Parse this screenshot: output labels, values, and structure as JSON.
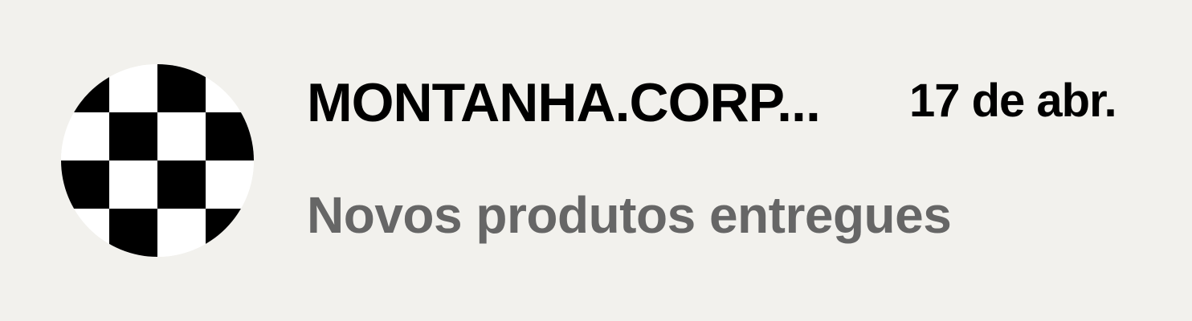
{
  "notification": {
    "sender": "MONTANHA.CORP...",
    "date": "17 de abr.",
    "subject": "Novos produtos entregues",
    "avatar_icon": "checkerboard-logo-icon"
  },
  "colors": {
    "background": "#f2f1ed",
    "sender_text": "#000000",
    "subject_text": "#666666",
    "avatar_dark": "#000000",
    "avatar_light": "#ffffff"
  }
}
